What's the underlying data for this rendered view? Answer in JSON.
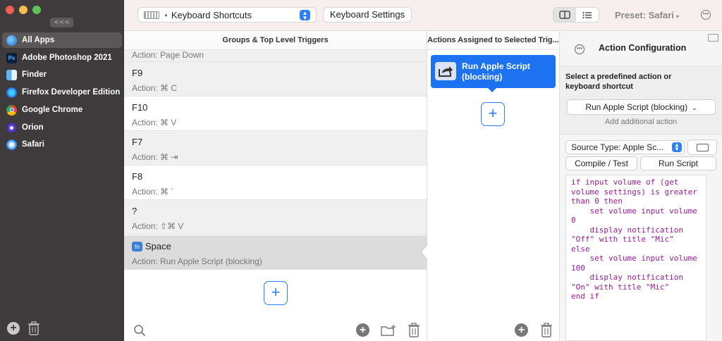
{
  "sidebar": {
    "collapse_label": "<<<",
    "apps": [
      {
        "label": "All Apps",
        "icon": "globe-icon",
        "selected": true
      },
      {
        "label": "Adobe Photoshop 2021",
        "icon": "photoshop-icon",
        "icon_text": "Ps"
      },
      {
        "label": "Finder",
        "icon": "finder-icon"
      },
      {
        "label": "Firefox Developer Edition",
        "icon": "firefox-icon"
      },
      {
        "label": "Google Chrome",
        "icon": "chrome-icon"
      },
      {
        "label": "Orion",
        "icon": "orion-icon"
      },
      {
        "label": "Safari",
        "icon": "safari-icon"
      }
    ],
    "add_symbol": "+"
  },
  "toolbar": {
    "select_label": "Keyboard Shortcuts",
    "settings_button": "Keyboard Settings",
    "preset_label": "Preset: Safari",
    "preset_caret": "▾"
  },
  "groups": {
    "header": "Groups & Top Level Triggers",
    "partial_action": "Action: Page Down",
    "triggers": [
      {
        "title": "F9",
        "action": "Action: ⌘ C"
      },
      {
        "title": "F10",
        "action": "Action: ⌘ V"
      },
      {
        "title": "F7",
        "action": "Action: ⌘ ⇥"
      },
      {
        "title": "F8",
        "action": "Action: ⌘ `"
      },
      {
        "title": "?",
        "action": "Action: ⇧⌘ V"
      },
      {
        "title": "Space",
        "action": "Action: Run Apple Script (blocking)",
        "badge": "fn",
        "selected": true
      }
    ],
    "add_symbol": "+"
  },
  "actions": {
    "header": "Actions Assigned to Selected Trig...",
    "card_label": "Run Apple Script (blocking)",
    "add_symbol": "+"
  },
  "config": {
    "title": "Action Configuration",
    "predefined_prompt": "Select a predefined action or keyboard shortcut",
    "predefined_value": "Run Apple Script (blocking)",
    "predefined_caret": "⌄",
    "add_additional": "Add additional action",
    "source_type": "Source Type: Apple Sc...",
    "compile_button": "Compile / Test",
    "run_button": "Run Script",
    "script": "if input volume of (get volume settings) is greater than 0 then\n    set volume input volume 0\n    display notification \"Off\" with title \"Mic\"\nelse\n    set volume input volume 100\n    display notification \"On\" with title \"Mic\"\nend if"
  },
  "colors": {
    "accent": "#1c72f0",
    "sidebar_bg": "#3f3a3b",
    "script_text": "#9a1a9a"
  }
}
